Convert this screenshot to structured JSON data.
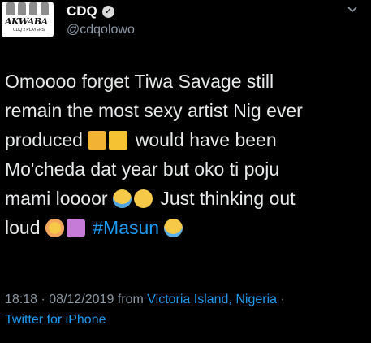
{
  "user": {
    "display_name": "CDQ",
    "handle": "@cdqolowo",
    "avatar_logo_text": "AKWABA",
    "avatar_sub_text": "CDQ x PLAYERS"
  },
  "tweet": {
    "lines": [
      [
        "Omoooo forget Tiwa Savage still"
      ],
      [
        "remain the most sexy artist Nig ever"
      ],
      [
        "produced",
        "would have been"
      ],
      [
        "Mo'cheda dat year but oko ti poju"
      ],
      [
        "mami loooor",
        "Just thinking out"
      ],
      [
        "loud",
        "#Masun"
      ]
    ]
  },
  "meta": {
    "time_date": "18:18 · 08/12/2019",
    "from_label": "from",
    "location": "Victoria Island, Nigeria",
    "separator": "·",
    "source": "Twitter for iPhone"
  },
  "colors": {
    "background": "#000000",
    "text": "#e7e9ea",
    "secondary": "#8b98a5",
    "link": "#1d9bf0"
  },
  "icons": {
    "verified": "verified-badge-icon",
    "more": "chevron-down-icon"
  }
}
